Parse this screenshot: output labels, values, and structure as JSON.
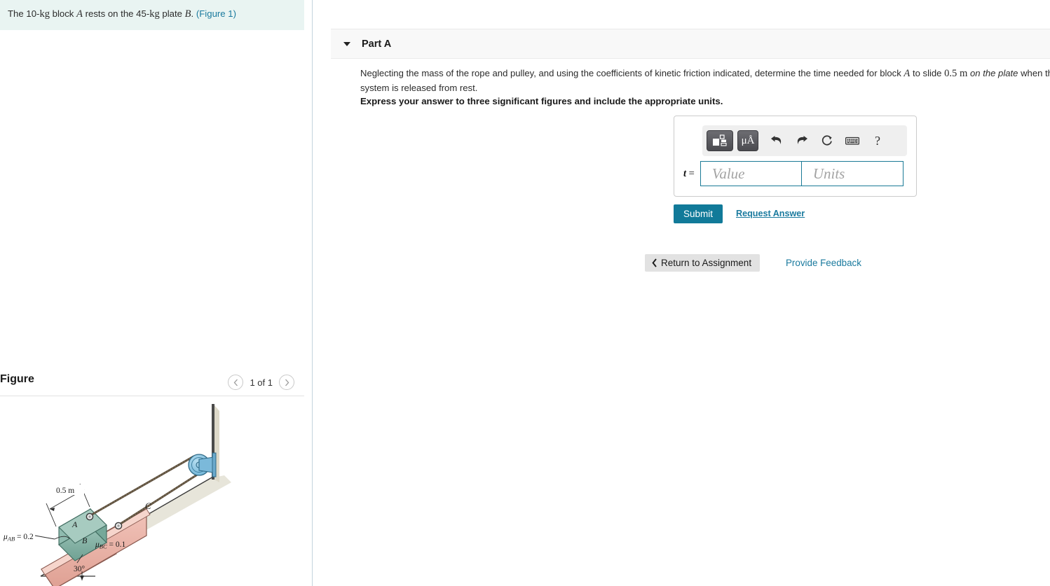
{
  "left": {
    "problem": {
      "pre": "The 10-",
      "unit1": "kg",
      "mid1": " block ",
      "varA": "A",
      "mid2": " rests on the 45-",
      "unit2": "kg",
      "mid3": " plate ",
      "varB": "B",
      "period": ". ",
      "figure_link": "(Figure 1)"
    },
    "figure": {
      "title": "Figure",
      "prev_icon": "chevron-left-icon",
      "next_icon": "chevron-right-icon",
      "count": "1 of 1",
      "labels": {
        "dim": "0.5 m",
        "mu_ab": "μ",
        "mu_ab_sub": "AB",
        "mu_ab_val": " = 0.2",
        "mu_bc": "μ",
        "mu_bc_sub": "BC",
        "mu_bc_val": " = 0.1",
        "block_a": "A",
        "block_b": "B",
        "incline_c": "C",
        "angle": "30°"
      },
      "colors": {
        "block_a_fill": "#86b5a8",
        "block_b_fill": "#e8b3a8",
        "pulley_fill": "#8ec6e0",
        "incline_fill": "#e8e6da",
        "rope": "#5b4e3c"
      }
    }
  },
  "right": {
    "part": {
      "caret_icon": "caret-down-icon",
      "label": "Part A"
    },
    "question": {
      "t1": "Neglecting the mass of the rope and pulley, and using the coefficients of kinetic friction indicated, determine the time needed for block ",
      "varA": "A",
      "t2": " to slide ",
      "dist": "0.5 m",
      "emph": " on the plate",
      "t3": " when the system is released from rest.",
      "express": "Express your answer to three significant figures and include the appropriate units."
    },
    "answer": {
      "var_label_name": "t",
      "var_label_eq": " =",
      "value_placeholder": "Value",
      "units_placeholder": "Units",
      "value": "",
      "units": "",
      "toolbar": [
        {
          "name": "template-icon",
          "label": ""
        },
        {
          "name": "units-icon",
          "label": "μÅ"
        },
        {
          "name": "undo-icon",
          "label": ""
        },
        {
          "name": "redo-icon",
          "label": ""
        },
        {
          "name": "reset-icon",
          "label": ""
        },
        {
          "name": "keyboard-icon",
          "label": ""
        },
        {
          "name": "help-icon",
          "label": "?"
        }
      ]
    },
    "actions": {
      "submit": "Submit",
      "request_answer": "Request Answer",
      "return_icon": "chevron-left-icon",
      "return": "Return to Assignment",
      "provide_feedback": "Provide Feedback"
    },
    "colors": {
      "accent": "#117a99",
      "link": "#1a7a9e",
      "input_border": "#1a7a96"
    }
  }
}
